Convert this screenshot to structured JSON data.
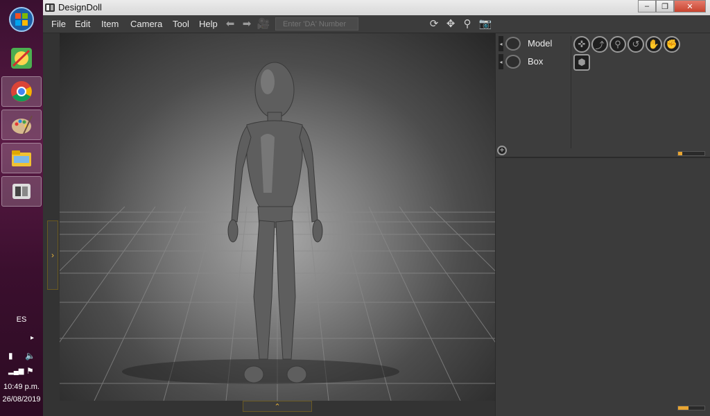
{
  "taskbar": {
    "language": "ES",
    "time": "10:49 p.m.",
    "date": "26/08/2019",
    "apps": [
      {
        "name": "start"
      },
      {
        "name": "sketch-app"
      },
      {
        "name": "chrome"
      },
      {
        "name": "paint-app"
      },
      {
        "name": "file-explorer"
      },
      {
        "name": "designdoll"
      }
    ]
  },
  "window": {
    "title": "DesignDoll",
    "minimize": "–",
    "restore": "❐",
    "close": "✕"
  },
  "menu": {
    "items": [
      "File",
      "Edit",
      "Item",
      "Camera",
      "Tool",
      "Help"
    ],
    "da_placeholder": "Enter 'DA' Number"
  },
  "toolbar_icons": [
    "back-arrow-icon",
    "forward-arrow-icon",
    "camera-film-icon",
    "rotate-icon",
    "move-icon",
    "zoom-icon",
    "screenshot-icon"
  ],
  "scene": {
    "items": [
      {
        "label": "Model"
      },
      {
        "label": "Box"
      }
    ]
  },
  "sliders": {
    "scene_zoom": 0.15,
    "props_zoom": 0.4
  },
  "colors": {
    "accent": "#e8a531",
    "panel": "#3a3a3a"
  }
}
